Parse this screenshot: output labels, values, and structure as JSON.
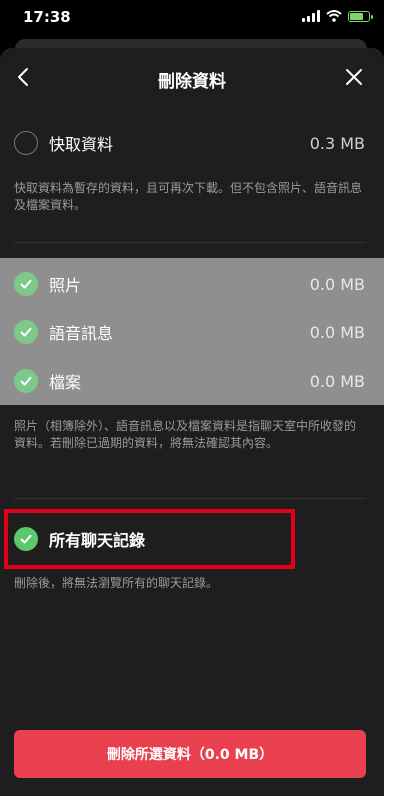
{
  "status_bar": {
    "time": "17:38"
  },
  "header": {
    "title": "刪除資料"
  },
  "cache": {
    "label": "快取資料",
    "size": "0.3 MB",
    "description": "快取資料為暫存的資料，且可再次下載。但不包含照片、語音訊息及檔案資料。"
  },
  "media": {
    "items": [
      {
        "label": "照片",
        "size": "0.0 MB"
      },
      {
        "label": "語音訊息",
        "size": "0.0 MB"
      },
      {
        "label": "檔案",
        "size": "0.0 MB"
      }
    ],
    "description": "照片（相簿除外）、語音訊息以及檔案資料是指聊天室中所收發的資料。若刪除已過期的資料，將無法確認其內容。"
  },
  "chats": {
    "label": "所有聊天記錄",
    "description": "刪除後，將無法瀏覽所有的聊天記錄。"
  },
  "action": {
    "delete_label": "刪除所選資料（0.0 MB）"
  },
  "colors": {
    "accent_red": "#e8404f",
    "check_green": "#5cc86d",
    "highlight": "#e3001b"
  }
}
